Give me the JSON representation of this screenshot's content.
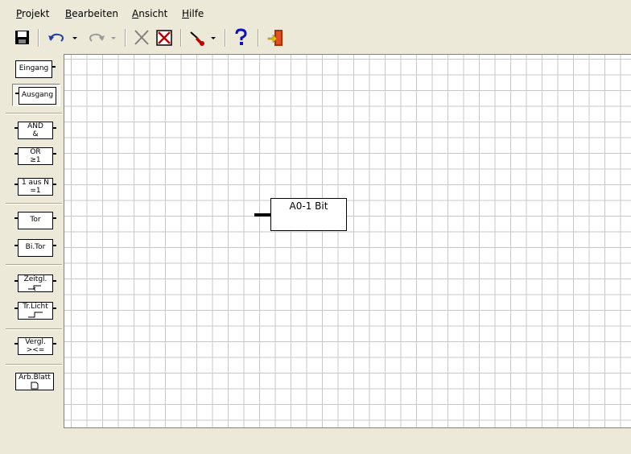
{
  "menu": {
    "items": [
      {
        "accel": "P",
        "rest": "rojekt"
      },
      {
        "accel": "B",
        "rest": "earbeiten"
      },
      {
        "accel": "A",
        "rest": "nsicht"
      },
      {
        "accel": "H",
        "rest": "ilfe"
      }
    ]
  },
  "toolbar": {
    "icons": [
      "save-icon",
      "undo-icon",
      "dropdown-arrow-icon",
      "redo-icon",
      "dropdown-arrow-icon",
      "delete-icon",
      "delete-all-icon",
      "pin-icon",
      "dropdown-arrow-icon",
      "help-icon",
      "exit-icon"
    ]
  },
  "palette": {
    "eingang": {
      "label": "Eingang"
    },
    "ausgang": {
      "label": "Ausgang"
    },
    "and": {
      "line1": "AND",
      "line2": "&"
    },
    "or": {
      "line1": "OR",
      "line2": "≥1"
    },
    "xor": {
      "line1": "1 aus N",
      "line2": "=1"
    },
    "tor": {
      "label": "Tor"
    },
    "bitor": {
      "label": "Bi.Tor"
    },
    "zeitgl": {
      "label": "Zeitgl."
    },
    "trlicht": {
      "label": "Tr.Licht"
    },
    "vergl": {
      "line1": "Vergl.",
      "line2": "><="
    },
    "arbblatt": {
      "label": "Arb.Blatt"
    }
  },
  "canvas": {
    "block": {
      "label": "A0-1 Bit"
    }
  }
}
